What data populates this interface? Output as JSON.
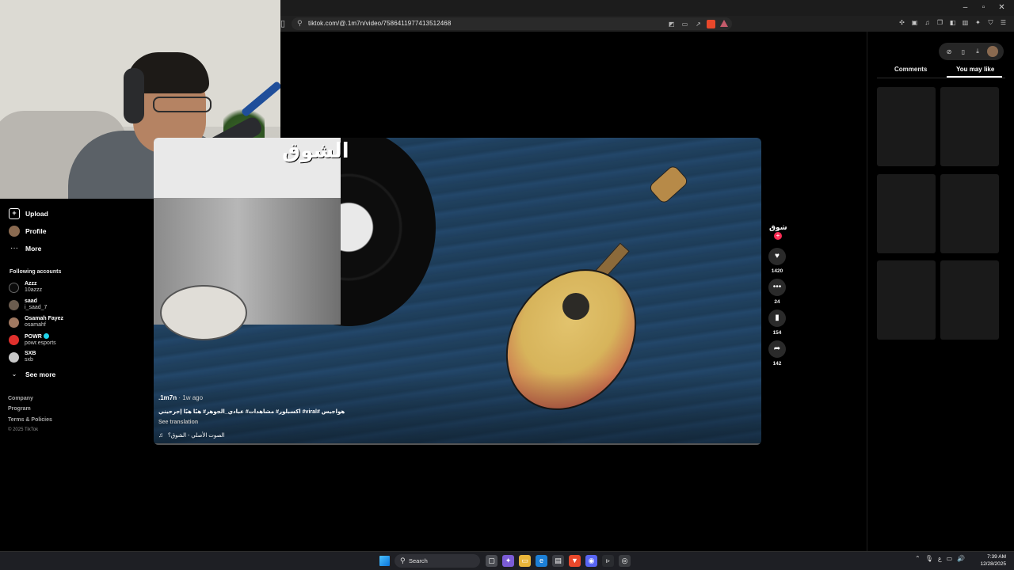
{
  "browser": {
    "url": "tiktok.com/@.1m7n/video/7586411977413512468",
    "window_controls": [
      "–",
      "▫",
      "✕"
    ]
  },
  "sidebar": {
    "nav": [
      {
        "label": "Upload",
        "icon": "upload-icon"
      },
      {
        "label": "Profile",
        "icon": "profile-avatar-icon"
      },
      {
        "label": "More",
        "icon": "more-dots-icon"
      }
    ],
    "following_heading": "Following accounts",
    "accounts": [
      {
        "name": "Azzz",
        "handle": "10azzz",
        "color": "#0b0b0b"
      },
      {
        "name": "saad",
        "handle": "i_saad_7",
        "color": "#6b5c4e"
      },
      {
        "name": "Osamah Fayez",
        "handle": "osamahf",
        "color": "#a07860"
      },
      {
        "name": "POWR",
        "handle": "powr.esports",
        "color": "#e0302c",
        "verified": true
      },
      {
        "name": "SXB",
        "handle": "sxb",
        "color": "#c9c9c9"
      }
    ],
    "see_more": "See more",
    "footer": [
      "Company",
      "Program",
      "Terms & Policies"
    ],
    "copyright": "© 2025 TikTok"
  },
  "video": {
    "cover_title": "الشوق",
    "author": ".1m7n",
    "age": "· 1w ago",
    "caption": "هواجيس #viral# اكسبلور# مشاهدات# عبادي_الجوهر# هبًا هبًا إجرحيني",
    "see_translation": "See translation",
    "sound": "الصوت الأصلي - الشوق؟"
  },
  "actions": {
    "creator_badge": "شوق",
    "like_count": "1420",
    "comment_count": "24",
    "save_count": "154",
    "share_count": "142"
  },
  "right_panel": {
    "tab_comments": "Comments",
    "tab_you_may_like": "You may like"
  },
  "taskbar": {
    "search_placeholder": "Search",
    "time": "7:39 AM",
    "date": "12/28/2025",
    "language": "ع"
  }
}
